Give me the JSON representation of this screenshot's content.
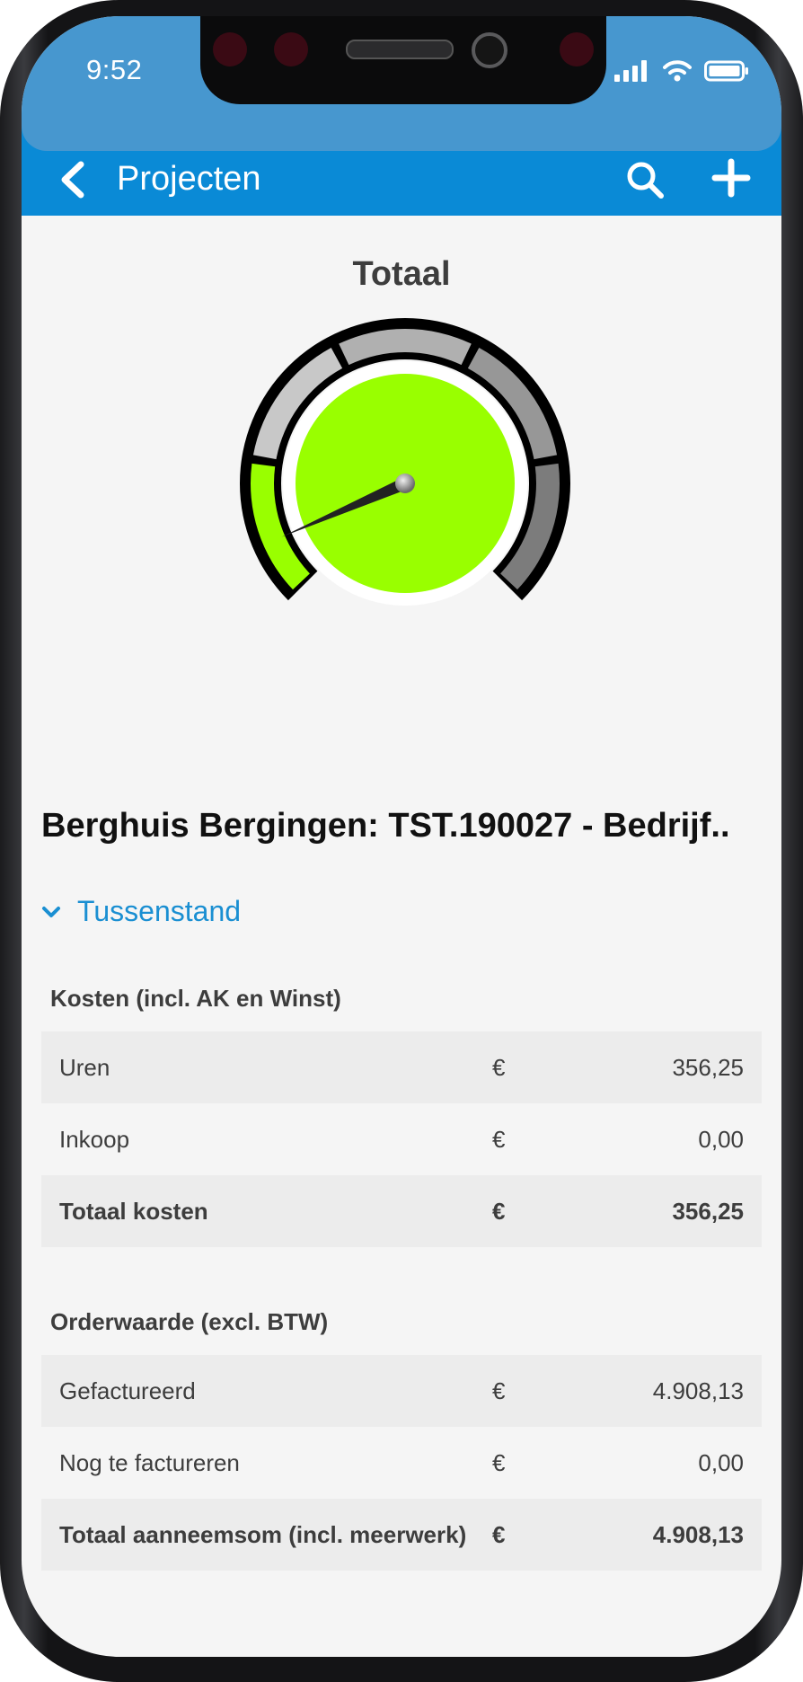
{
  "status_bar": {
    "time": "9:52"
  },
  "app_bar": {
    "title": "Projecten"
  },
  "gauge": {
    "title": "Totaal",
    "fill_color": "#99ff00",
    "needle_fraction": 0.08
  },
  "project": {
    "title": "Berghuis Bergingen: TST.190027 - Bedrijf.."
  },
  "section": {
    "label": "Tussenstand",
    "accent": "#1a8fd2"
  },
  "costs": {
    "title": "Kosten (incl. AK en Winst)",
    "rows": [
      {
        "label": "Uren",
        "currency": "€",
        "amount": "356,25"
      },
      {
        "label": "Inkoop",
        "currency": "€",
        "amount": "0,00"
      },
      {
        "label": "Totaal kosten",
        "currency": "€",
        "amount": "356,25"
      }
    ]
  },
  "order": {
    "title": "Orderwaarde (excl. BTW)",
    "rows": [
      {
        "label": "Gefactureerd",
        "currency": "€",
        "amount": "4.908,13"
      },
      {
        "label": "Nog te factureren",
        "currency": "€",
        "amount": "0,00"
      },
      {
        "label": "Totaal aanneemsom (incl. meerwerk)",
        "currency": "€",
        "amount": "4.908,13"
      }
    ]
  }
}
